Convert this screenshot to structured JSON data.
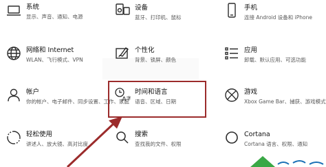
{
  "tiles": {
    "system": {
      "title": "系统",
      "desc": "显示、声音、通知、电源"
    },
    "devices": {
      "title": "设备",
      "desc": "蓝牙、打印机、鼠标"
    },
    "phone": {
      "title": "手机",
      "desc": "连接 Android 设备和 iPhone"
    },
    "network": {
      "title": "网络和 Internet",
      "desc": "WLAN、飞行模式、VPN"
    },
    "personalization": {
      "title": "个性化",
      "desc": "背景、锁屏、颜色"
    },
    "apps": {
      "title": "应用",
      "desc": "卸载、默认应用、可选功能"
    },
    "accounts": {
      "title": "帐户",
      "desc": "你的帐户、电子邮件、同步设置、工作、家庭"
    },
    "time_language": {
      "title": "时间和语言",
      "desc": "语音、区域、日期"
    },
    "gaming": {
      "title": "游戏",
      "desc": "Xbox Game Bar、捕获、游戏模式"
    },
    "ease": {
      "title": "轻松使用",
      "desc": "讲述人、放大镜、高对比度"
    },
    "search": {
      "title": "搜索",
      "desc": "查找我的文件、权限"
    },
    "cortana": {
      "title": "Cortana",
      "desc": "Cortana 语言、权限、通知"
    }
  },
  "colors": {
    "highlight_border": "#9b2b2b",
    "arrow": "#9b2b2b",
    "icon": "#2b2b2b",
    "watermark": "#3aa846"
  },
  "icons": {
    "system": "laptop-icon",
    "devices": "keyboard-speaker-icon",
    "phone": "phone-icon",
    "network": "globe-icon",
    "personalization": "paint-brush-icon",
    "apps": "apps-list-icon",
    "accounts": "person-icon",
    "time_language": "time-language-icon",
    "gaming": "xbox-icon",
    "ease": "ease-of-access-icon",
    "search": "search-icon",
    "cortana": "cortana-circle-icon"
  }
}
